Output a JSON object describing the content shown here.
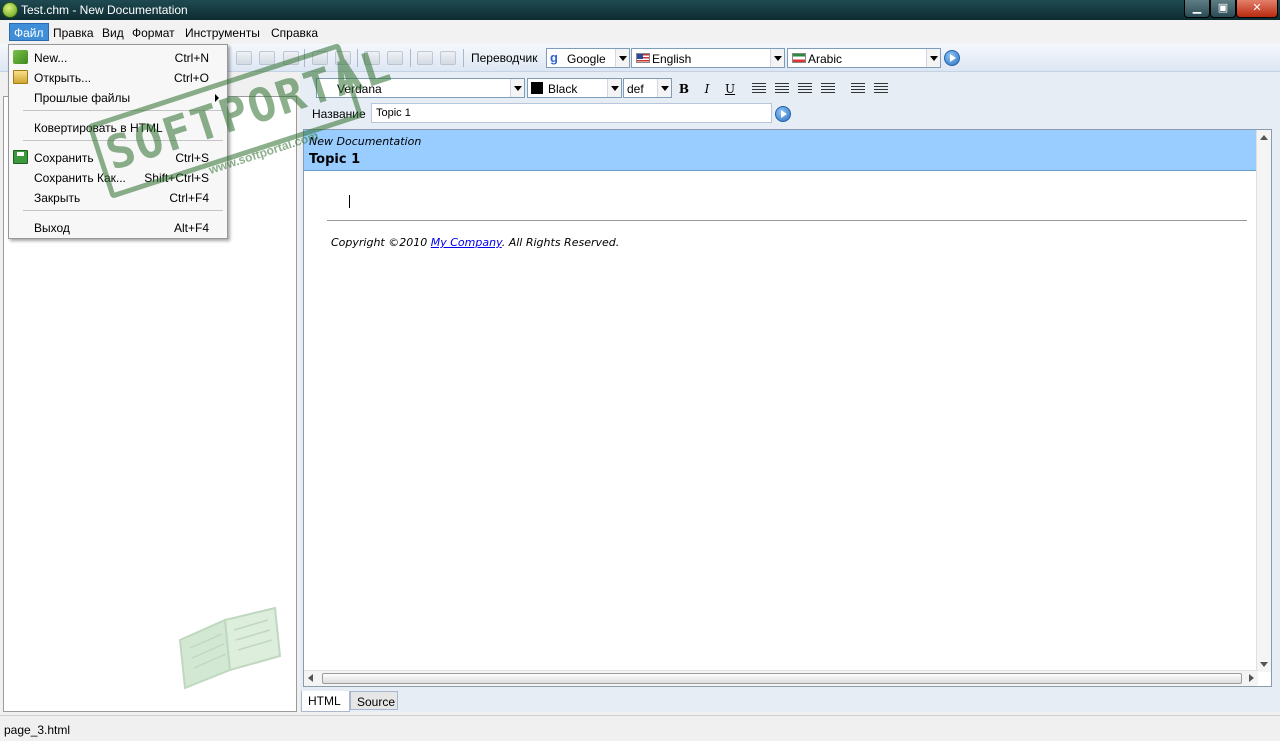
{
  "window": {
    "title": "Test.chm - New Documentation"
  },
  "menubar": {
    "items": [
      "Файл",
      "Правка",
      "Вид",
      "Формат",
      "Инструменты",
      "Справка"
    ]
  },
  "file_menu": {
    "items": [
      {
        "label": "New...",
        "shortcut": "Ctrl+N",
        "icon": "new-doc-icon"
      },
      {
        "label": "Открыть...",
        "shortcut": "Ctrl+O",
        "icon": "open-folder-icon"
      },
      {
        "label": "Прошлые файлы",
        "shortcut": "",
        "submenu": true
      },
      {
        "label": "Ковертировать в HTML",
        "shortcut": ""
      },
      {
        "label": "Сохранить",
        "shortcut": "Ctrl+S",
        "icon": "save-icon"
      },
      {
        "label": "Сохранить Как...",
        "shortcut": "Shift+Ctrl+S"
      },
      {
        "label": "Закрыть",
        "shortcut": "Ctrl+F4"
      },
      {
        "label": "Выход",
        "shortcut": "Alt+F4"
      }
    ]
  },
  "toolbar": {
    "translator_label": "Переводчик",
    "engine": "Google",
    "source_language": "English",
    "target_language": "Arabic"
  },
  "format": {
    "font": "Verdana",
    "color": "Black",
    "size": "def",
    "bold": "B",
    "italic": "I",
    "underline": "U"
  },
  "topic": {
    "name_label": "Название",
    "name_value": "Topic 1"
  },
  "document": {
    "header_name": "New Documentation",
    "topic_title": "Topic 1",
    "copyright_prefix": "Copyright ©2010 ",
    "company_link": "My Company",
    "copyright_suffix": ". All Rights Reserved."
  },
  "tabs": {
    "html": "HTML",
    "source": "Source"
  },
  "status": {
    "text": "page_3.html"
  },
  "watermark": {
    "text": "SOFTPORTAL",
    "url": "www.softportal.com"
  },
  "colors": {
    "doc_header": "#99ccff",
    "titlebar": "#1f4a52",
    "menu_active": "#3e8fd8"
  }
}
